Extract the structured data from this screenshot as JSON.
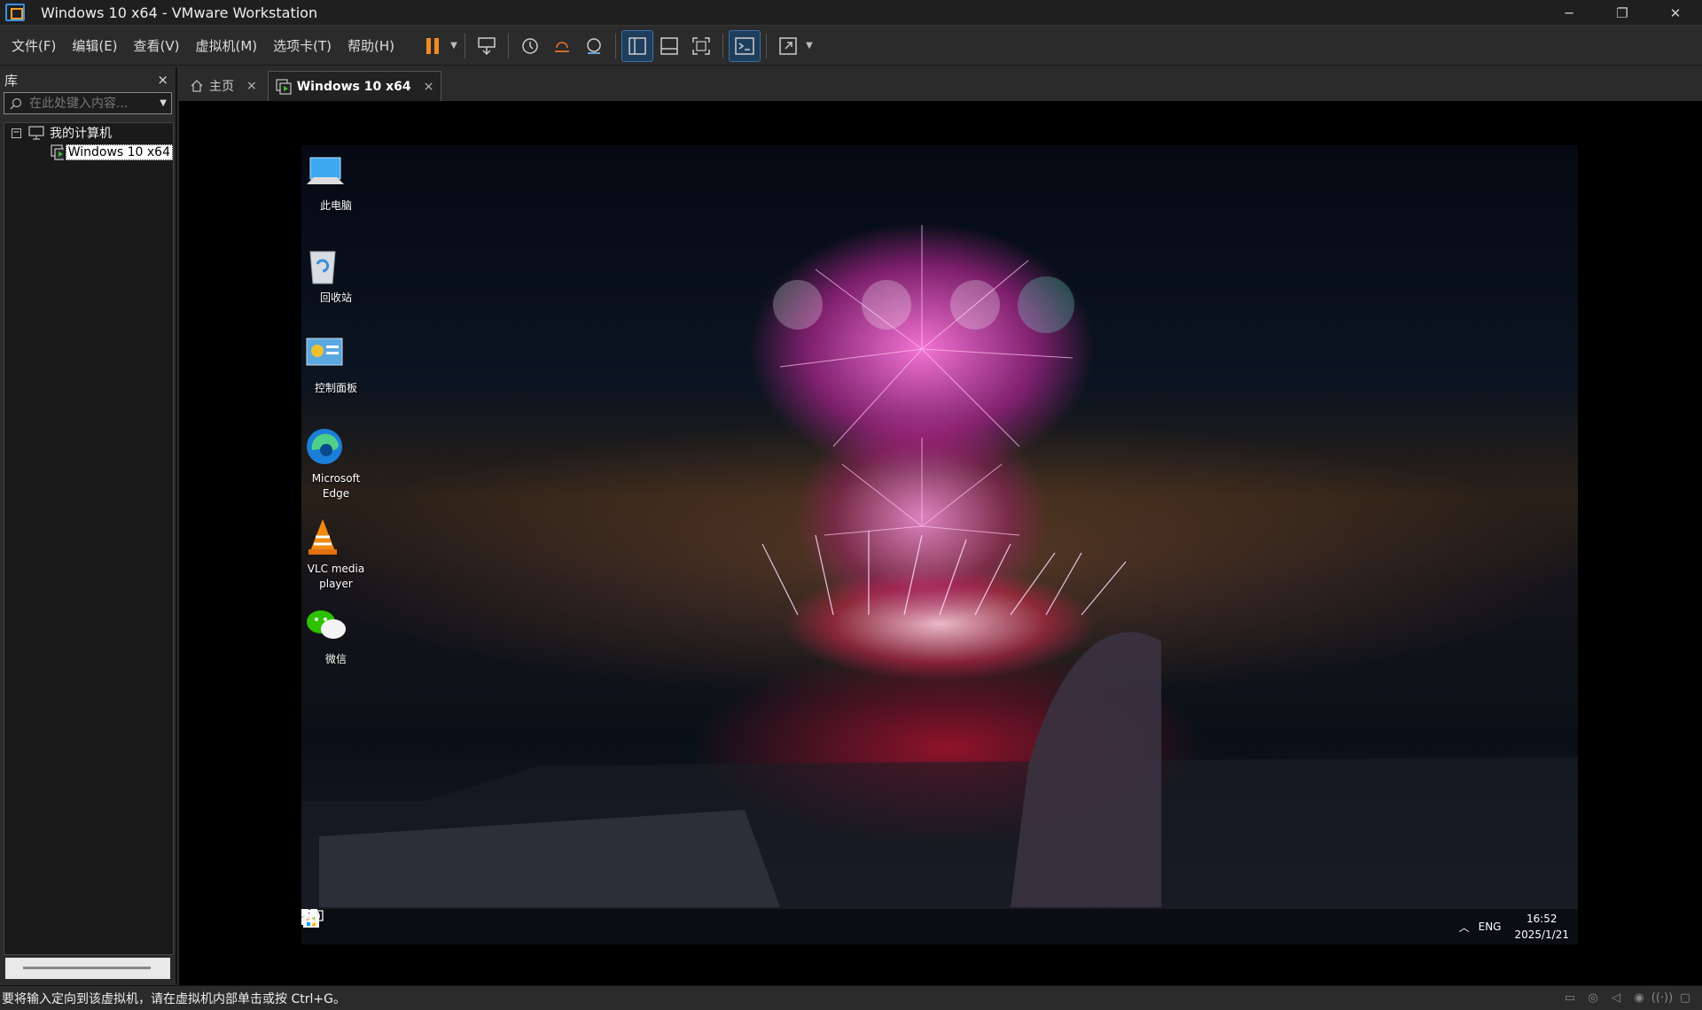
{
  "window": {
    "title": "Windows 10 x64 - VMware Workstation"
  },
  "menu": [
    "文件(F)",
    "编辑(E)",
    "查看(V)",
    "虚拟机(M)",
    "选项卡(T)",
    "帮助(H)"
  ],
  "sidebar": {
    "title": "库",
    "close": "×",
    "search_placeholder": "在此处键入内容...",
    "tree": {
      "root": "我的计算机",
      "root_expander": "−",
      "vm": "Windows 10 x64"
    }
  },
  "tabs": [
    {
      "label": "主页",
      "close": "×",
      "icon": "home-icon"
    },
    {
      "label": "Windows 10 x64",
      "close": "×",
      "icon": "vm-icon"
    }
  ],
  "desktop": {
    "icons": [
      {
        "label": "此电脑",
        "icon": "computer-icon"
      },
      {
        "label": "回收站",
        "icon": "recycle-bin-icon"
      },
      {
        "label": "控制面板",
        "icon": "control-panel-icon"
      },
      {
        "label": "Microsoft Edge",
        "icon": "edge-icon"
      },
      {
        "label": "VLC media player",
        "icon": "vlc-icon"
      },
      {
        "label": "微信",
        "icon": "wechat-icon"
      }
    ]
  },
  "taskbar": {
    "lang": "ENG",
    "time": "16:52",
    "date": "2025/1/21"
  },
  "status": {
    "message": "要将输入定向到该虚拟机，请在虚拟机内部单击或按 Ctrl+G。"
  },
  "colors": {
    "accent": "#3b6fa0",
    "pause": "#f08a24",
    "background": "#2b2b2b"
  }
}
